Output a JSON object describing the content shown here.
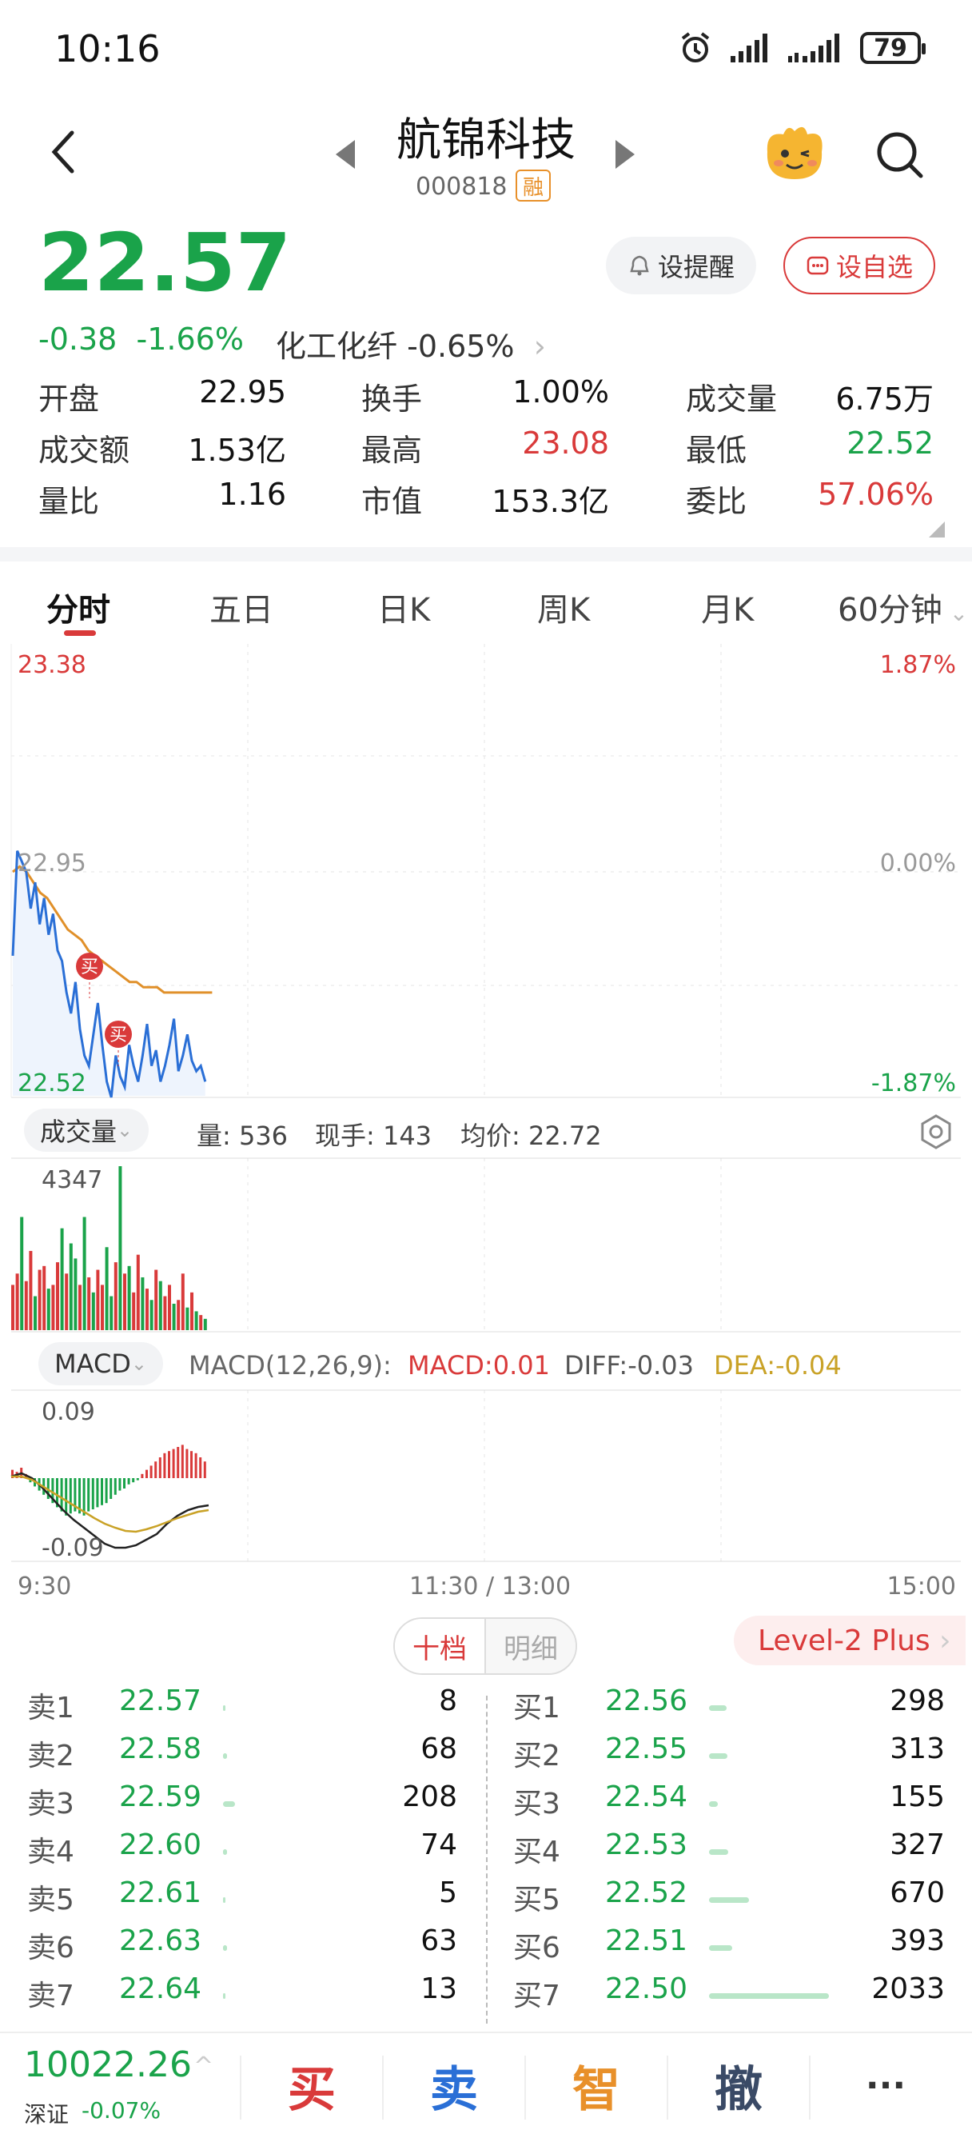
{
  "status": {
    "time": "10:16",
    "battery": "79"
  },
  "header": {
    "title": "航锦科技",
    "code": "000818",
    "margin_badge": "融"
  },
  "quote": {
    "price": "22.57",
    "change": "-0.38",
    "change_pct": "-1.66%",
    "sector_name": "化工化纤",
    "sector_pct": "-0.65%",
    "remind_label": "设提醒",
    "watch_label": "设自选",
    "stats": [
      [
        {
          "label": "开盘",
          "value": "22.95",
          "color": "neutral"
        },
        {
          "label": "换手",
          "value": "1.00%",
          "color": "neutral"
        },
        {
          "label": "成交量",
          "value": "6.75万",
          "color": "neutral"
        }
      ],
      [
        {
          "label": "成交额",
          "value": "1.53亿",
          "color": "neutral"
        },
        {
          "label": "最高",
          "value": "23.08",
          "color": "up"
        },
        {
          "label": "最低",
          "value": "22.52",
          "color": "down"
        }
      ],
      [
        {
          "label": "量比",
          "value": "1.16",
          "color": "neutral"
        },
        {
          "label": "市值",
          "value": "153.3亿",
          "color": "neutral"
        },
        {
          "label": "委比",
          "value": "57.06%",
          "color": "up"
        }
      ]
    ]
  },
  "tabs": [
    "分时",
    "五日",
    "日K",
    "周K",
    "月K",
    "60分钟"
  ],
  "chart": {
    "price_top": "23.38",
    "price_mid": "22.95",
    "price_bottom": "22.52",
    "pct_top": "1.87%",
    "pct_mid": "0.00%",
    "pct_bottom": "-1.87%",
    "buy_marker": "买",
    "volume_selector": "成交量",
    "volume_info": "量: 536",
    "current_vol": "现手: 143",
    "avg_price": "均价: 22.72",
    "volume_max": "4347",
    "macd_selector": "MACD",
    "macd_params": "MACD(12,26,9):",
    "macd_val": "MACD:0.01",
    "diff_val": "DIFF:-0.03",
    "dea_val": "DEA:-0.04",
    "macd_top": "0.09",
    "macd_bottom": "-0.09",
    "time_start": "9:30",
    "time_mid": "11:30 / 13:00",
    "time_end": "15:00",
    "colors": {
      "up": "#d93a3a",
      "down": "#1aa34a",
      "line": "#2a6fd6",
      "avg": "#e0902a",
      "dea": "#c9a227"
    }
  },
  "orderbook": {
    "tab_active": "十档",
    "tab_inactive": "明细",
    "level2": "Level-2 Plus",
    "sell": [
      {
        "label": "卖1",
        "price": "22.57",
        "qty": "8",
        "ratio": 0.004
      },
      {
        "label": "卖2",
        "price": "22.58",
        "qty": "68",
        "ratio": 0.033
      },
      {
        "label": "卖3",
        "price": "22.59",
        "qty": "208",
        "ratio": 0.1
      },
      {
        "label": "卖4",
        "price": "22.60",
        "qty": "74",
        "ratio": 0.036
      },
      {
        "label": "卖5",
        "price": "22.61",
        "qty": "5",
        "ratio": 0.003
      },
      {
        "label": "卖6",
        "price": "22.63",
        "qty": "63",
        "ratio": 0.031
      },
      {
        "label": "卖7",
        "price": "22.64",
        "qty": "13",
        "ratio": 0.006
      }
    ],
    "buy": [
      {
        "label": "买1",
        "price": "22.56",
        "qty": "298",
        "ratio": 0.147
      },
      {
        "label": "买2",
        "price": "22.55",
        "qty": "313",
        "ratio": 0.154
      },
      {
        "label": "买3",
        "price": "22.54",
        "qty": "155",
        "ratio": 0.076
      },
      {
        "label": "买4",
        "price": "22.53",
        "qty": "327",
        "ratio": 0.161
      },
      {
        "label": "买5",
        "price": "22.52",
        "qty": "670",
        "ratio": 0.33
      },
      {
        "label": "买6",
        "price": "22.51",
        "qty": "393",
        "ratio": 0.193
      },
      {
        "label": "买7",
        "price": "22.50",
        "qty": "2033",
        "ratio": 1.0
      }
    ]
  },
  "bottom": {
    "index_value": "10022.26",
    "index_name": "深证",
    "index_change": "-0.07%",
    "buy": "买",
    "sell": "卖",
    "smart": "智",
    "cancel": "撤",
    "more": "···"
  }
}
